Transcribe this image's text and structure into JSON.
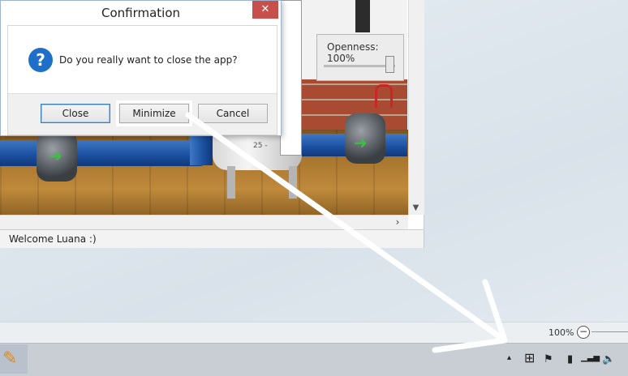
{
  "dialog": {
    "title": "Confirmation",
    "close_glyph": "✕",
    "question_glyph": "?",
    "message": "Do you really want to close the app?",
    "buttons": {
      "close": "Close",
      "minimize": "Minimize",
      "cancel": "Cancel"
    }
  },
  "app": {
    "openness_label": "Openness: 100%",
    "openness_value": 100,
    "status_text": "Welcome Luana :)",
    "tank_scale": "25 -",
    "valve_arrow": "➜",
    "scroll_down_glyph": "▼",
    "scroll_right_glyph": "›"
  },
  "bottom_bar": {
    "zoom_text": "100%",
    "zoom_out_glyph": "−"
  },
  "tray": {
    "icons": [
      "chevron-up-icon",
      "windows-flag-icon",
      "action-center-flag-icon",
      "battery-icon",
      "signal-icon",
      "volume-icon"
    ],
    "glyphs": {
      "chevron": "▴",
      "windows": "⊞",
      "flag": "⚑",
      "battery": "▮",
      "signal": "▁▃▅",
      "volume": "🔈"
    }
  },
  "colors": {
    "dialog_close": "#c7504d",
    "question_icon": "#1e6fc8",
    "pipe": "#1a4f9e",
    "brick": "#a94a33",
    "arrow_green": "#36c43a"
  },
  "annotation": {
    "arrow_color": "#ffffff"
  }
}
